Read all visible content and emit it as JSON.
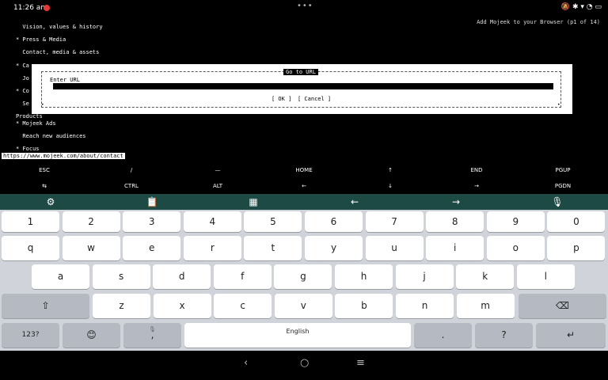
{
  "status_bar": {
    "time": "11:26 am",
    "notification_badge": "",
    "icons": "🔕 ✱ ▾ ◔ ▭"
  },
  "terminal": {
    "title": "Add Mojeek to your Browser (p1 of 14)",
    "lines": [
      "  Vision, values & history",
      "",
      "* Press & Media",
      "",
      "  Contact, media & assets",
      "",
      "* Ca",
      "",
      "  Jo",
      "",
      "* Co",
      "",
      "  Se",
      "",
      "Products",
      "* Mojeek Ads",
      "",
      "  Reach new audiences",
      "",
      "* Focus"
    ],
    "status_url": "https://www.mojeek.com/about/contact"
  },
  "dialog": {
    "title": "Go to URL",
    "label": "Enter URL",
    "url_value": "",
    "ok_label": "[ OK ]",
    "cancel_label": "[ Cancel ]"
  },
  "extra_keys": {
    "row1": [
      "ESC",
      "/",
      "—",
      "HOME",
      "↑",
      "END",
      "PGUP"
    ],
    "row2": [
      "⇆",
      "CTRL",
      "ALT",
      "←",
      "↓",
      "→",
      "PGDN"
    ]
  },
  "keyboard_toolbar": {
    "icons": [
      "gear-icon",
      "clipboard-icon",
      "calculator-icon",
      "arrow-left-icon",
      "arrow-right-icon",
      "mic-icon"
    ]
  },
  "keyboard": {
    "number_row": [
      "1",
      "2",
      "3",
      "4",
      "5",
      "6",
      "7",
      "8",
      "9",
      "0"
    ],
    "row1": [
      "q",
      "w",
      "e",
      "r",
      "t",
      "y",
      "u",
      "i",
      "o",
      "p"
    ],
    "row2": [
      "a",
      "s",
      "d",
      "f",
      "g",
      "h",
      "j",
      "k",
      "l"
    ],
    "row3": [
      "z",
      "x",
      "c",
      "v",
      "b",
      "n",
      "m"
    ],
    "symbols_label": "123?",
    "comma_label": ",",
    "space_label": "English",
    "period_label": ".",
    "question_label": "?"
  },
  "colors": {
    "toolbar_bg": "#1d4a45",
    "keyboard_bg": "#d0d3d9",
    "key_bg": "#ffffff",
    "key_dark_bg": "#b5b9c1"
  }
}
